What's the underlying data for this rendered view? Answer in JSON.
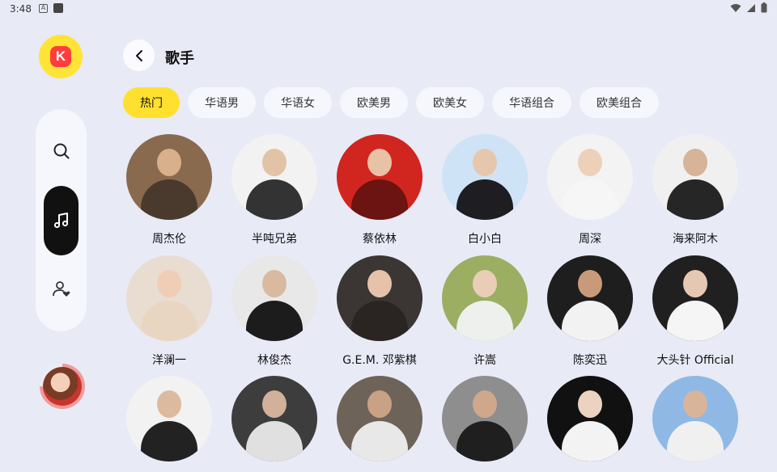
{
  "status": {
    "time": "3:48",
    "a_icon": "A"
  },
  "header": {
    "title": "歌手"
  },
  "tabs": [
    {
      "label": "热门",
      "active": true
    },
    {
      "label": "华语男",
      "active": false
    },
    {
      "label": "华语女",
      "active": false
    },
    {
      "label": "欧美男",
      "active": false
    },
    {
      "label": "欧美女",
      "active": false
    },
    {
      "label": "华语组合",
      "active": false
    },
    {
      "label": "欧美组合",
      "active": false
    }
  ],
  "artists": [
    {
      "name": "周杰伦",
      "bg": "#8a6a4e",
      "skin": "#d9b08c",
      "cloth": "#4a3a2e"
    },
    {
      "name": "半吨兄弟",
      "bg": "#f2f2f2",
      "skin": "#e2c3a6",
      "cloth": "#333333"
    },
    {
      "name": "蔡依林",
      "bg": "#d1251f",
      "skin": "#e9c2a5",
      "cloth": "#6b1411"
    },
    {
      "name": "白小白",
      "bg": "#cfe3f6",
      "skin": "#e6c7ad",
      "cloth": "#1d1d22"
    },
    {
      "name": "周深",
      "bg": "#f3f3f3",
      "skin": "#ecd0b8",
      "cloth": "#f6f6f6"
    },
    {
      "name": "海来阿木",
      "bg": "#f0f0f0",
      "skin": "#d7b397",
      "cloth": "#262626"
    },
    {
      "name": "洋澜一",
      "bg": "#e9dcd0",
      "skin": "#f0cdb5",
      "cloth": "#e9d6c2"
    },
    {
      "name": "林俊杰",
      "bg": "#e8e8e8",
      "skin": "#d9b9a0",
      "cloth": "#1c1c1c"
    },
    {
      "name": "G.E.M. 邓紫棋",
      "bg": "#3b3634",
      "skin": "#e7c2ab",
      "cloth": "#2a2523"
    },
    {
      "name": "许嵩",
      "bg": "#9cae62",
      "skin": "#eacdb6",
      "cloth": "#eef0ee"
    },
    {
      "name": "陈奕迅",
      "bg": "#1e1e1e",
      "skin": "#c99a79",
      "cloth": "#f2f2f2"
    },
    {
      "name": "大头针 Official",
      "bg": "#202020",
      "skin": "#e5c8b3",
      "cloth": "#f5f5f5"
    },
    {
      "name": "",
      "bg": "#f2f2f2",
      "skin": "#dcbaa0",
      "cloth": "#222222"
    },
    {
      "name": "",
      "bg": "#3d3d3d",
      "skin": "#d2b09a",
      "cloth": "#e0e0e0"
    },
    {
      "name": "",
      "bg": "#6e6358",
      "skin": "#c9a184",
      "cloth": "#e8e8e8"
    },
    {
      "name": "",
      "bg": "#8e8e8e",
      "skin": "#cfa78a",
      "cloth": "#1f1f1f"
    },
    {
      "name": "",
      "bg": "#111111",
      "skin": "#ecd2c0",
      "cloth": "#f3f3f3"
    },
    {
      "name": "",
      "bg": "#8fb9e4",
      "skin": "#d8b49a",
      "cloth": "#f0f0f0"
    }
  ]
}
